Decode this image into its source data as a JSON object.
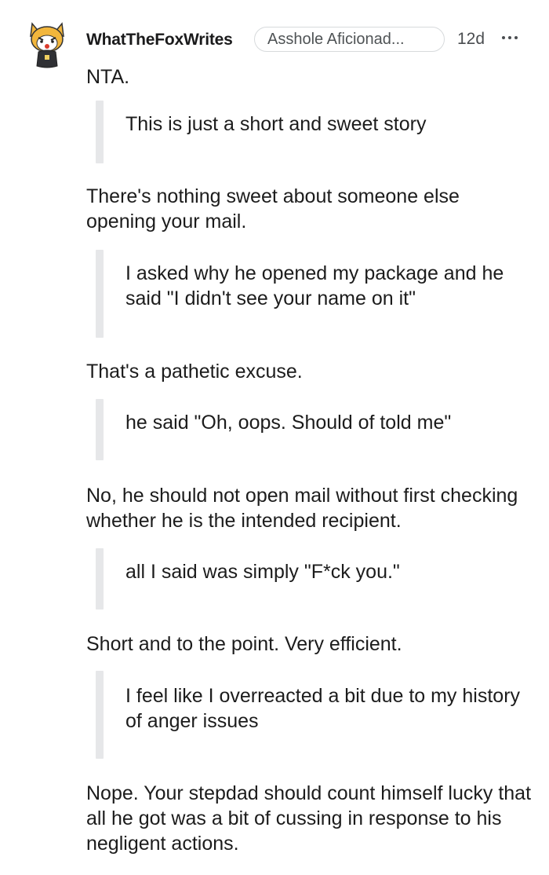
{
  "comment": {
    "author": "WhatTheFoxWrites",
    "flair": "Asshole Aficionad...",
    "age": "12d",
    "more_icon": "ellipsis-icon",
    "avatar_icon": "fox-avatar-icon",
    "colors": {
      "text": "#1c1c1c",
      "quote_bar": "#e6e7e9",
      "flair_border": "#d7dadc",
      "meta": "#4a4d50"
    },
    "blocks": [
      {
        "type": "text",
        "text": "NTA."
      },
      {
        "type": "quote",
        "text": "This is just a short and sweet story"
      },
      {
        "type": "text",
        "text": "There's nothing sweet about someone else opening your mail."
      },
      {
        "type": "quote",
        "text": "I asked why he opened my package and he said \"I didn't see your name on it\""
      },
      {
        "type": "text",
        "text": "That's a pathetic excuse."
      },
      {
        "type": "quote",
        "text": "he said \"Oh, oops. Should of told me\""
      },
      {
        "type": "text",
        "text": "No, he should not open mail without first checking whether he is the intended recipient."
      },
      {
        "type": "quote",
        "text": "all I said was simply \"F*ck you.\""
      },
      {
        "type": "text",
        "text": "Short and to the point. Very efficient."
      },
      {
        "type": "quote",
        "text": "I feel like I overreacted a bit due to my history of anger issues"
      },
      {
        "type": "text",
        "text": "Nope. Your stepdad should count himself lucky that all he got was a bit of cussing in response to his negligent actions."
      }
    ]
  }
}
